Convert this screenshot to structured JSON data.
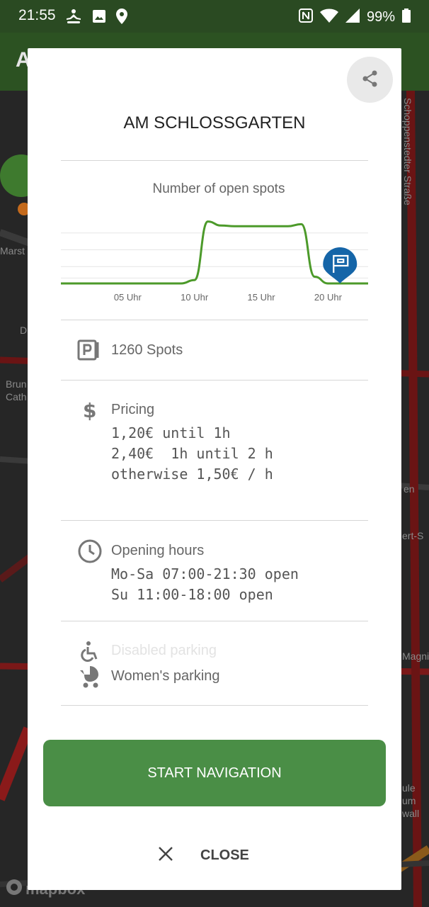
{
  "status_bar": {
    "time": "21:55",
    "battery": "99%"
  },
  "app_bar": {
    "title_fragment": "A"
  },
  "map": {
    "labels": [
      "Schoppenstedter Straße",
      "Marst",
      "D",
      "Brun",
      "Cath",
      "en",
      "ert-S",
      "Magni",
      "ule",
      "um",
      "wall"
    ],
    "attribution": "mapbox"
  },
  "dialog": {
    "title": "AM SCHLOSSGARTEN",
    "chart_title": "Number of open spots",
    "spots": "1260 Spots",
    "pricing": {
      "label": "Pricing",
      "lines": [
        "1,20€ until 1h",
        "2,40€  1h until 2 h",
        "otherwise 1,50€ / h"
      ]
    },
    "opening_hours": {
      "label": "Opening hours",
      "lines": [
        "Mo-Sa 07:00-21:30 open",
        "Su 11:00-18:00 open"
      ]
    },
    "disabled_parking": "Disabled parking",
    "womens_parking": "Women's parking",
    "start_button": "START NAVIGATION",
    "close_button": "CLOSE"
  },
  "colors": {
    "accent_green": "#4a8e46",
    "chart_line": "#4c9a2a",
    "marker_blue": "#1565a8"
  },
  "chart_data": {
    "type": "line",
    "title": "Number of open spots",
    "x_tick_labels": [
      "05 Uhr",
      "10 Uhr",
      "15 Uhr",
      "20 Uhr"
    ],
    "x_hours": [
      0,
      1,
      2,
      3,
      4,
      5,
      6,
      7,
      8,
      9,
      10,
      11,
      12,
      13,
      14,
      15,
      16,
      17,
      18,
      19,
      20,
      21,
      22,
      23
    ],
    "values": [
      0,
      0,
      0,
      0,
      0,
      0,
      0,
      0,
      0,
      0,
      0.05,
      0.92,
      0.86,
      0.85,
      0.85,
      0.85,
      0.85,
      0.85,
      0.88,
      0.1,
      0,
      0,
      0,
      0
    ],
    "marker_hour": 21,
    "grid": true
  }
}
